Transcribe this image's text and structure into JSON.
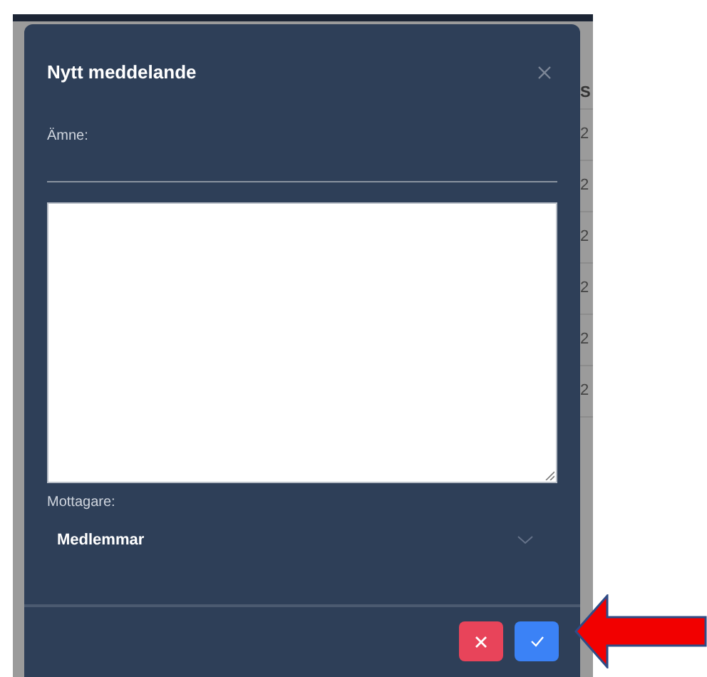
{
  "background_table": {
    "header": "S",
    "cells": [
      "2",
      "2",
      "2",
      "2",
      "2",
      "2"
    ]
  },
  "dialog": {
    "title": "Nytt meddelande",
    "subject": {
      "label": "Ämne:"
    },
    "recipient": {
      "label": "Mottagare:",
      "value": "Medlemmar"
    },
    "buttons": [
      {
        "kind": "cancel"
      },
      {
        "kind": "confirm"
      }
    ]
  }
}
